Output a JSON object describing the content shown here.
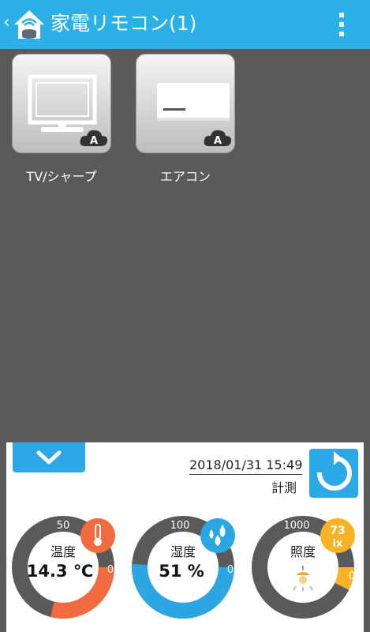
{
  "appbar": {
    "back": "‹",
    "title": "家電リモコン(1)"
  },
  "devices": [
    {
      "label": "TV/シャープ",
      "badge": "A",
      "icon": "tv-icon"
    },
    {
      "label": "エアコン",
      "badge": "A",
      "icon": "air-conditioner-icon"
    }
  ],
  "sensor_panel": {
    "datetime": "2018/01/31 15:49",
    "measure_label": "計測",
    "gauges": [
      {
        "name": "温度",
        "value": 14.3,
        "display": "14.3 ℃",
        "max": "50",
        "min": "0",
        "fill": 0.29,
        "color": "#f26a3f",
        "icon": "thermometer-icon"
      },
      {
        "name": "湿度",
        "value": 51,
        "display": "51 %",
        "max": "100",
        "min": "0",
        "fill": 0.51,
        "color": "#2ba6e3",
        "icon": "water-drops-icon"
      },
      {
        "name": "照度",
        "value": 73,
        "display": "",
        "max": "1000",
        "min": "0",
        "fill": 0.073,
        "color": "#f7b225",
        "icon": "lightbulb-icon",
        "badge_value": "73",
        "badge_unit": "lx"
      }
    ]
  }
}
